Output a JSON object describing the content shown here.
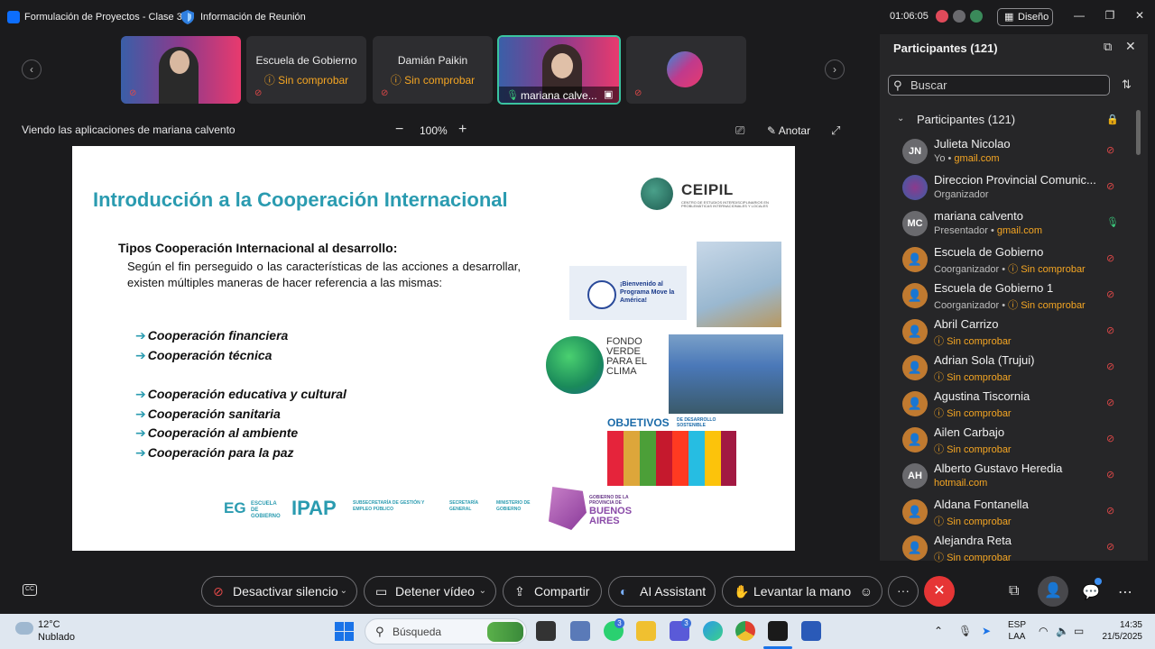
{
  "titlebar": {
    "meeting_title": "Formulación de Proyectos - Clase 3",
    "info_label": "Información de Reunión",
    "elapsed": "01:06:05",
    "layout_label": "Diseño"
  },
  "thumbnails": [
    {
      "name": "",
      "status": ""
    },
    {
      "name": "Escuela de Gobierno",
      "status": "Sin comprobar"
    },
    {
      "name": "Damián Paikin",
      "status": "Sin comprobar"
    },
    {
      "name": "mariana calve...",
      "status": ""
    },
    {
      "name": "",
      "status": ""
    }
  ],
  "share": {
    "label": "Viendo las aplicaciones de mariana calvento",
    "zoom": "100%",
    "annotate": "Anotar"
  },
  "slide": {
    "title": "Introducción a la Cooperación Internacional",
    "logo_text": "CEIPIL",
    "logo_sub": "CENTRO DE ESTUDIOS INTERDISCIPLINARIOS EN PROBLEMÁTICAS INTERNACIONALES Y LOCALES",
    "heading": "Tipos Cooperación Internacional al desarrollo:",
    "paragraph": "Según el fin perseguido o las características de las acciones a desarrollar, existen múltiples maneras de hacer referencia a las mismas:",
    "list_a": [
      "Cooperación financiera",
      "Cooperación técnica"
    ],
    "list_b": [
      "Cooperación educativa  y cultural",
      "Cooperación sanitaria",
      "Cooperación al ambiente",
      "Cooperación para la paz"
    ],
    "move_banner": "¡Bienvenido al Programa Move la América!",
    "fondo": "FONDO VERDE PARA EL CLIMA",
    "ods": "OBJETIVOS",
    "ods_sub": "DE DESARROLLO SOSTENIBLE",
    "footer": {
      "eg": "EG",
      "eg_text": "ESCUELA DE GOBIERNO",
      "ipap": "IPAP",
      "subsec": "SUBSECRETARÍA DE GESTIÓN Y EMPLEO PÚBLICO",
      "secretaria": "SECRETARÍA GENERAL",
      "ministerio": "MINISTERIO DE GOBIERNO",
      "ba_small": "GOBIERNO DE LA PROVINCIA DE",
      "ba": "BUENOS AIRES"
    }
  },
  "panel": {
    "title": "Participantes (121)",
    "search_placeholder": "Buscar",
    "group_label": "Participantes (121)",
    "participants": [
      {
        "initials": "JN",
        "name": "Julieta Nicolao",
        "role": "Yo",
        "extra": "gmail.com",
        "type": "initials",
        "mic": "off"
      },
      {
        "initials": "",
        "name": "Direccion Provincial Comunic...",
        "role": "Organizador",
        "extra": "",
        "type": "org",
        "mic": "off"
      },
      {
        "initials": "MC",
        "name": "mariana calvento",
        "role": "Presentador",
        "extra": "gmail.com",
        "type": "initials",
        "mic": "on"
      },
      {
        "initials": "",
        "name": "Escuela de Gobierno",
        "role": "Coorganizador",
        "extra": "Sin comprobar",
        "type": "person",
        "mic": "off"
      },
      {
        "initials": "",
        "name": "Escuela de Gobierno 1",
        "role": "Coorganizador",
        "extra": "Sin comprobar",
        "type": "person",
        "mic": "off"
      },
      {
        "initials": "",
        "name": "Abril Carrizo",
        "role": "",
        "extra": "Sin comprobar",
        "type": "person",
        "mic": "off"
      },
      {
        "initials": "",
        "name": "Adrian Sola (Trujui)",
        "role": "",
        "extra": "Sin comprobar",
        "type": "person",
        "mic": "off"
      },
      {
        "initials": "",
        "name": "Agustina Tiscornia",
        "role": "",
        "extra": "Sin comprobar",
        "type": "person",
        "mic": "off"
      },
      {
        "initials": "",
        "name": "Ailen Carbajo",
        "role": "",
        "extra": "Sin comprobar",
        "type": "person",
        "mic": "off"
      },
      {
        "initials": "AH",
        "name": "Alberto Gustavo Heredia",
        "role": "",
        "extra": "hotmail.com",
        "type": "initials",
        "mic": "off"
      },
      {
        "initials": "",
        "name": "Aldana Fontanella",
        "role": "",
        "extra": "Sin comprobar",
        "type": "person",
        "mic": "off"
      },
      {
        "initials": "",
        "name": "Alejandra Reta",
        "role": "",
        "extra": "Sin comprobar",
        "type": "person",
        "mic": "off"
      }
    ]
  },
  "controls": {
    "mute": "Desactivar silencio",
    "video": "Detener vídeo",
    "share": "Compartir",
    "ai": "AI Assistant",
    "hand": "Levantar la mano"
  },
  "taskbar": {
    "temp": "12°C",
    "condition": "Nublado",
    "search": "Búsqueda",
    "lang1": "ESP",
    "lang2": "LAA",
    "time": "14:35",
    "date": "21/5/2025",
    "badge_whatsapp": "3",
    "badge_teams": "3"
  }
}
